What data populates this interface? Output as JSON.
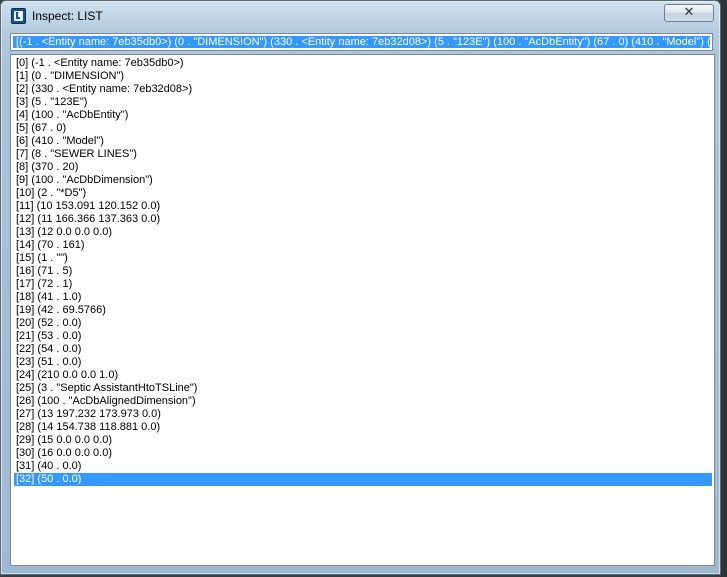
{
  "window": {
    "title": "Inspect: LIST",
    "close_label": "✕"
  },
  "top_field": {
    "value": "[(-1 . <Entity name: 7eb35db0>) (0 . \"DIMENSION\") (330 . <Entity name: 7eb32d08>) (5 . \"123E\") (100 . \"AcDbEntity\") (67 . 0) (410 . \"Model\") (8 . \""
  },
  "list": {
    "items": [
      "[0] (-1 . <Entity name: 7eb35db0>)",
      "[1] (0 . \"DIMENSION\")",
      "[2] (330 . <Entity name: 7eb32d08>)",
      "[3] (5 . \"123E\")",
      "[4] (100 . \"AcDbEntity\")",
      "[5] (67 . 0)",
      "[6] (410 . \"Model\")",
      "[7] (8 . \"SEWER LINES\")",
      "[8] (370 . 20)",
      "[9] (100 . \"AcDbDimension\")",
      "[10] (2 . \"*D5\")",
      "[11] (10 153.091 120.152 0.0)",
      "[12] (11 166.366 137.363 0.0)",
      "[13] (12 0.0 0.0 0.0)",
      "[14] (70 . 161)",
      "[15] (1 . \"\")",
      "[16] (71 . 5)",
      "[17] (72 . 1)",
      "[18] (41 . 1.0)",
      "[19] (42 . 69.5766)",
      "[20] (52 . 0.0)",
      "[21] (53 . 0.0)",
      "[22] (54 . 0.0)",
      "[23] (51 . 0.0)",
      "[24] (210 0.0 0.0 1.0)",
      "[25] (3 . \"Septic AssistantHtoTSLine\")",
      "[26] (100 . \"AcDbAlignedDimension\")",
      "[27] (13 197.232 173.973 0.0)",
      "[28] (14 154.738 118.881 0.0)",
      "[29] (15 0.0 0.0 0.0)",
      "[30] (16 0.0 0.0 0.0)",
      "[31] (40 . 0.0)",
      "[32] (50 . 0.0)"
    ],
    "selected_index": 32
  },
  "colors": {
    "selection": "#3399ff",
    "selection_text": "#ffffff"
  }
}
